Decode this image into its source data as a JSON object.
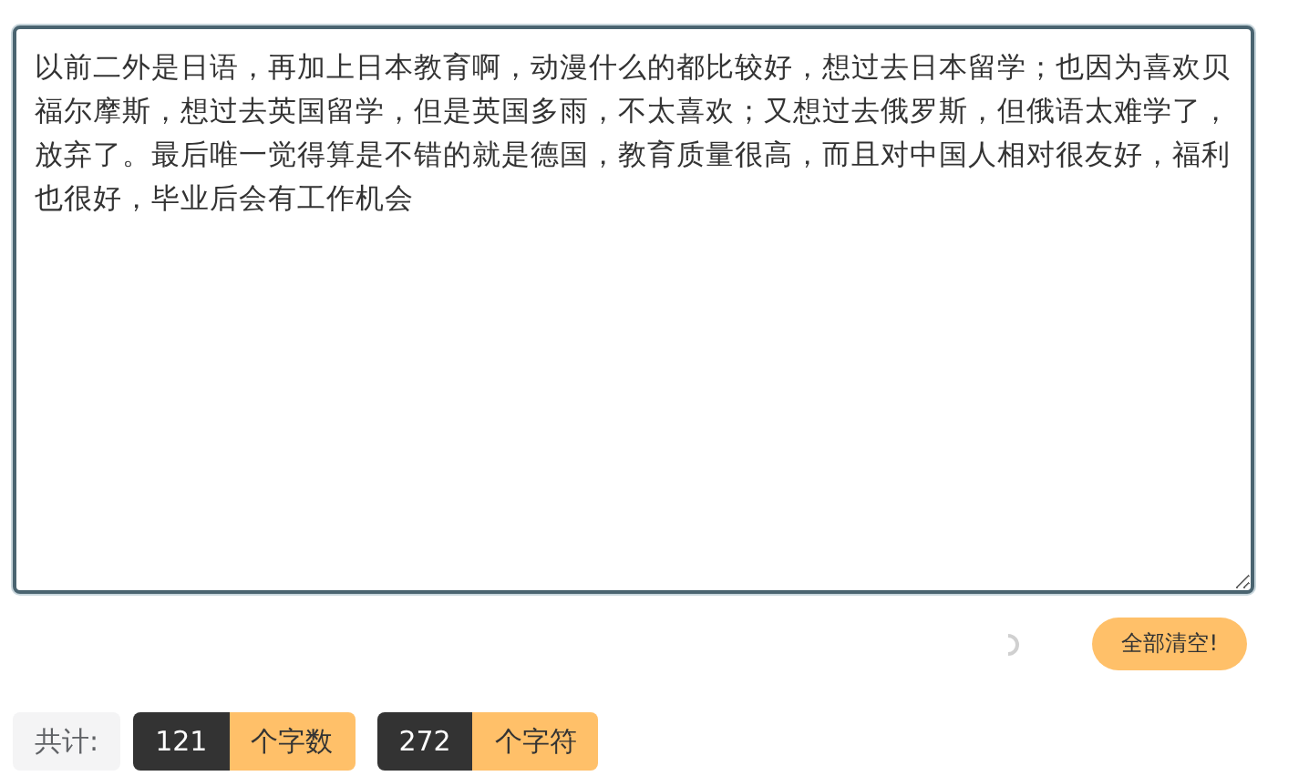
{
  "editor": {
    "value": "以前二外是日语，再加上日本教育啊，动漫什么的都比较好，想过去日本留学；也因为喜欢贝福尔摩斯，想过去英国留学，但是英国多雨，不太喜欢；又想过去俄罗斯，但俄语太难学了，放弃了。最后唯一觉得算是不错的就是德国，教育质量很高，而且对中国人相对很友好，福利也很好，毕业后会有工作机会"
  },
  "actions": {
    "loading": true,
    "clear_button": "全部清空!"
  },
  "stats": {
    "label": "共计:",
    "counts": [
      {
        "value": "121",
        "unit": "个字数"
      },
      {
        "value": "272",
        "unit": "个字符"
      }
    ]
  }
}
